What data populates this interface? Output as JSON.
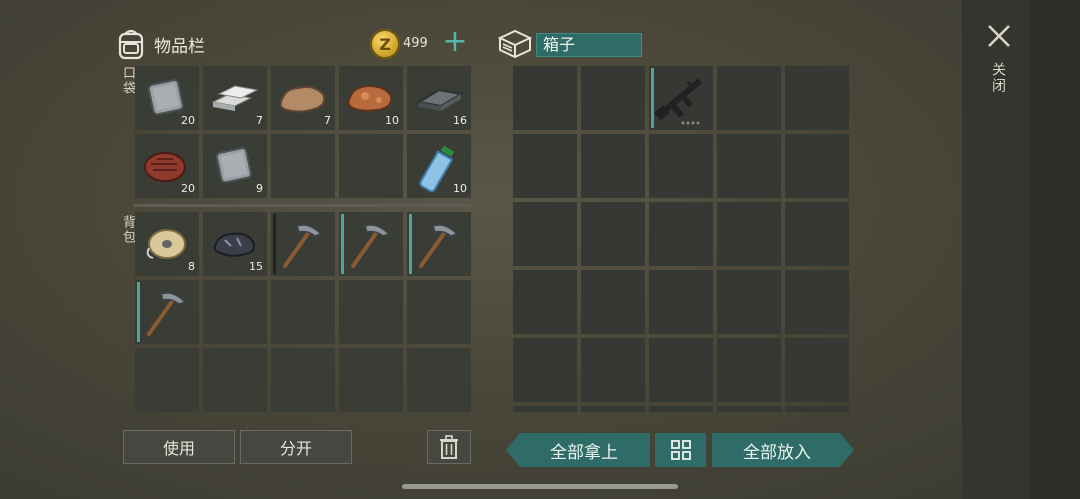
{
  "inventory": {
    "title": "物品栏",
    "coins": "499",
    "pocket_label": "口袋",
    "backpack_label": "背包",
    "pocket": [
      {
        "icon": "metal-plate-icon",
        "count": "20",
        "bar": ""
      },
      {
        "icon": "iron-bars-icon",
        "count": "7",
        "bar": ""
      },
      {
        "icon": "stone-ore-icon",
        "count": "7",
        "bar": ""
      },
      {
        "icon": "copper-ore-icon",
        "count": "10",
        "bar": ""
      },
      {
        "icon": "steel-ingot-icon",
        "count": "16",
        "bar": ""
      },
      {
        "icon": "raw-meat-icon",
        "count": "20",
        "bar": ""
      },
      {
        "icon": "metal-plate-icon",
        "count": "9",
        "bar": ""
      },
      {
        "icon": "",
        "count": "",
        "bar": ""
      },
      {
        "icon": "",
        "count": "",
        "bar": ""
      },
      {
        "icon": "water-bottle-icon",
        "count": "10",
        "bar": ""
      }
    ],
    "backpack": [
      {
        "icon": "rope-spool-icon",
        "count": "8",
        "bar": ""
      },
      {
        "icon": "coal-ore-icon",
        "count": "15",
        "bar": ""
      },
      {
        "icon": "pickaxe-icon",
        "count": "",
        "bar": "dark"
      },
      {
        "icon": "pickaxe-icon",
        "count": "",
        "bar": "teal"
      },
      {
        "icon": "pickaxe-icon",
        "count": "",
        "bar": "teal"
      },
      {
        "icon": "pickaxe-icon",
        "count": "",
        "bar": "teal"
      },
      {
        "icon": "",
        "count": "",
        "bar": ""
      },
      {
        "icon": "",
        "count": "",
        "bar": ""
      },
      {
        "icon": "",
        "count": "",
        "bar": ""
      },
      {
        "icon": "",
        "count": "",
        "bar": ""
      },
      {
        "icon": "",
        "count": "",
        "bar": ""
      },
      {
        "icon": "",
        "count": "",
        "bar": ""
      },
      {
        "icon": "",
        "count": "",
        "bar": ""
      },
      {
        "icon": "",
        "count": "",
        "bar": ""
      },
      {
        "icon": "",
        "count": "",
        "bar": ""
      }
    ]
  },
  "box": {
    "name": "箱子",
    "weapon_slot": 2,
    "weapon_icon": "assault-rifle-icon"
  },
  "buttons": {
    "use": "使用",
    "split": "分开",
    "take_all": "全部拿上",
    "put_all": "全部放入",
    "close": "关闭"
  },
  "colors": {
    "accent": "#2f6c67",
    "accent_bright": "#4fb8aa",
    "slot": "#3a3c36"
  }
}
